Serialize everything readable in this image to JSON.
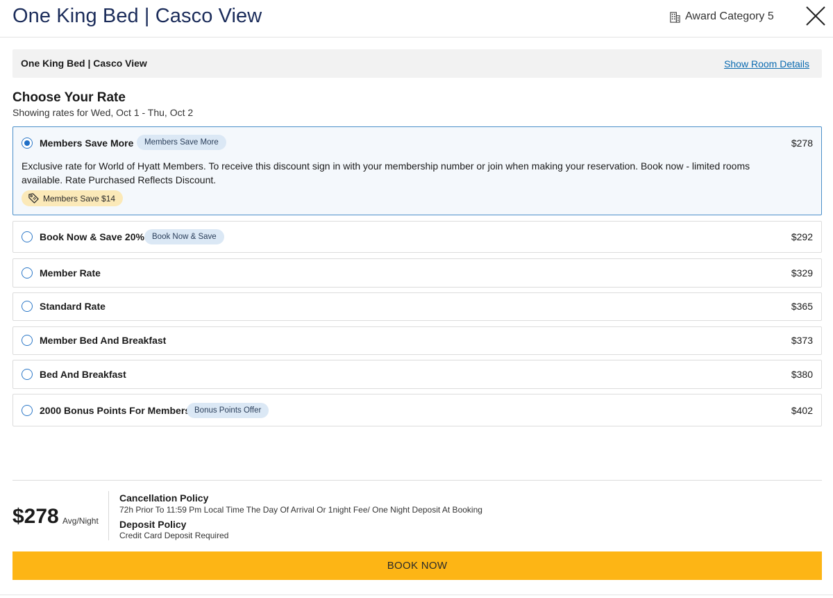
{
  "header": {
    "title": "One King Bed | Casco View",
    "award_category": "Award Category 5",
    "close_icon": "close-icon",
    "building_icon": "building-icon"
  },
  "room_bar": {
    "name": "One King Bed | Casco View",
    "details_link": "Show Room Details"
  },
  "rates_section": {
    "title": "Choose Your Rate",
    "subtitle": "Showing rates for Wed, Oct 1 - Thu, Oct 2"
  },
  "rates": [
    {
      "name": "Members Save More",
      "badge": "Members Save More",
      "price": "$278",
      "selected": true,
      "description": "Exclusive rate for World of Hyatt Members. To receive this discount sign in with your membership number or join when making your reservation. Book now - limited rooms available. Rate Purchased Reflects Discount.",
      "savings": "Members Save $14"
    },
    {
      "name": "Book Now & Save 20%",
      "badge": "Book Now & Save",
      "price": "$292",
      "selected": false
    },
    {
      "name": "Member Rate",
      "badge": "",
      "price": "$329",
      "selected": false
    },
    {
      "name": "Standard Rate",
      "badge": "",
      "price": "$365",
      "selected": false
    },
    {
      "name": "Member Bed And Breakfast",
      "badge": "",
      "price": "$373",
      "selected": false
    },
    {
      "name": "Bed And Breakfast",
      "badge": "",
      "price": "$380",
      "selected": false
    },
    {
      "name": "2000 Bonus Points For Members",
      "badge": "Bonus Points Offer",
      "price": "$402",
      "selected": false
    }
  ],
  "summary": {
    "price": "$278",
    "price_unit": "Avg/Night",
    "cancellation_title": "Cancellation Policy",
    "cancellation_text": "72h Prior To 11:59 Pm Local Time The Day Of Arrival Or 1night Fee/ One Night Deposit At Booking",
    "deposit_title": "Deposit Policy",
    "deposit_text": "Credit Card Deposit Required"
  },
  "book_button": "BOOK NOW",
  "colors": {
    "title_navy": "#1b2c5a",
    "link_blue": "#0a6ab0",
    "radio_blue": "#1f6fc6",
    "badge_bg": "#dbe8f5",
    "savings_bg": "#fbe9b8",
    "book_yellow": "#fdb515"
  }
}
